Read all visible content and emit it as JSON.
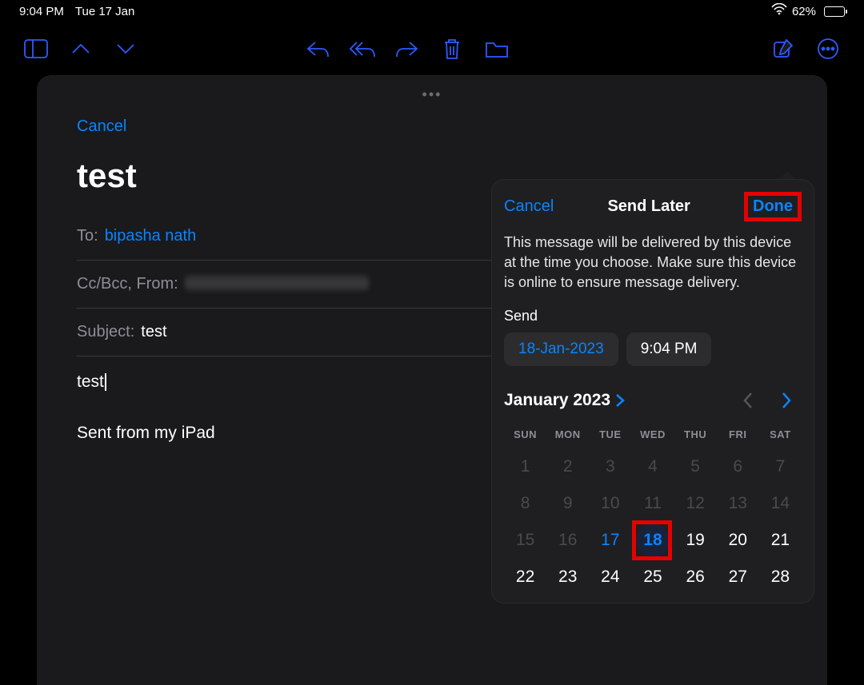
{
  "status": {
    "time": "9:04 PM",
    "date": "Tue 17 Jan",
    "battery_pct": "62%"
  },
  "compose": {
    "cancel": "Cancel",
    "title": "test",
    "to_label": "To:",
    "to_value": "bipasha nath",
    "cc_label": "Cc/Bcc, From:",
    "subject_label": "Subject:",
    "subject_value": "test",
    "body": "test",
    "signature": "Sent from my iPad"
  },
  "popover": {
    "cancel": "Cancel",
    "title": "Send Later",
    "done": "Done",
    "description": "This message will be delivered by this device at the time you choose. Make sure this device is online to ensure message delivery.",
    "send_label": "Send",
    "date_pill": "18-Jan-2023",
    "time_pill": "9:04 PM",
    "month_label": "January 2023",
    "weekdays": [
      "SUN",
      "MON",
      "TUE",
      "WED",
      "THU",
      "FRI",
      "SAT"
    ],
    "weeks": [
      [
        {
          "n": "1",
          "dim": true
        },
        {
          "n": "2",
          "dim": true
        },
        {
          "n": "3",
          "dim": true
        },
        {
          "n": "4",
          "dim": true
        },
        {
          "n": "5",
          "dim": true
        },
        {
          "n": "6",
          "dim": true
        },
        {
          "n": "7",
          "dim": true
        }
      ],
      [
        {
          "n": "8",
          "dim": true
        },
        {
          "n": "9",
          "dim": true
        },
        {
          "n": "10",
          "dim": true
        },
        {
          "n": "11",
          "dim": true
        },
        {
          "n": "12",
          "dim": true
        },
        {
          "n": "13",
          "dim": true
        },
        {
          "n": "14",
          "dim": true
        }
      ],
      [
        {
          "n": "15",
          "dim": true
        },
        {
          "n": "16",
          "dim": true
        },
        {
          "n": "17",
          "today": true
        },
        {
          "n": "18",
          "selected": true
        },
        {
          "n": "19"
        },
        {
          "n": "20"
        },
        {
          "n": "21"
        }
      ],
      [
        {
          "n": "22"
        },
        {
          "n": "23"
        },
        {
          "n": "24"
        },
        {
          "n": "25"
        },
        {
          "n": "26"
        },
        {
          "n": "27"
        },
        {
          "n": "28"
        }
      ]
    ]
  }
}
